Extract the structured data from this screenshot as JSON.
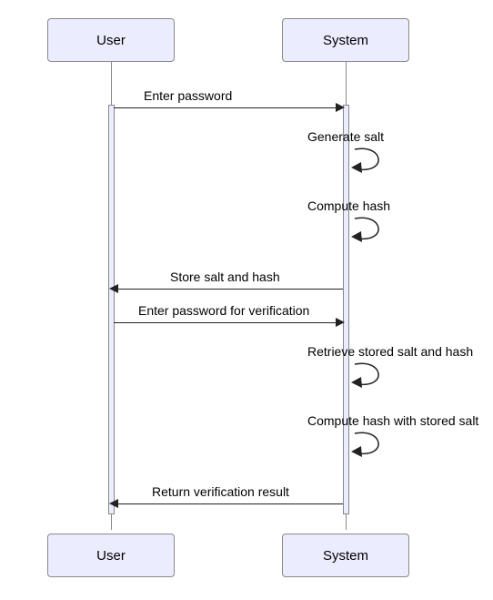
{
  "chart_data": {
    "type": "sequence_diagram",
    "participants": [
      "User",
      "System"
    ],
    "messages": [
      {
        "from": "User",
        "to": "System",
        "label": "Enter password",
        "kind": "sync"
      },
      {
        "from": "System",
        "to": "System",
        "label": "Generate salt",
        "kind": "self"
      },
      {
        "from": "System",
        "to": "System",
        "label": "Compute hash",
        "kind": "self"
      },
      {
        "from": "System",
        "to": "User",
        "label": "Store salt and hash",
        "kind": "sync"
      },
      {
        "from": "User",
        "to": "System",
        "label": "Enter password for verification",
        "kind": "sync"
      },
      {
        "from": "System",
        "to": "System",
        "label": "Retrieve stored salt and hash",
        "kind": "self"
      },
      {
        "from": "System",
        "to": "System",
        "label": "Compute hash with stored salt",
        "kind": "self"
      },
      {
        "from": "System",
        "to": "User",
        "label": "Return verification result",
        "kind": "sync"
      }
    ]
  },
  "participants": {
    "user": {
      "label": "User"
    },
    "system": {
      "label": "System"
    }
  },
  "messages": {
    "m1": "Enter password",
    "m2": "Generate salt",
    "m3": "Compute hash",
    "m4": "Store salt and hash",
    "m5": "Enter password for verification",
    "m6": "Retrieve stored salt and hash",
    "m7": "Compute hash with stored salt",
    "m8": "Return verification result"
  }
}
